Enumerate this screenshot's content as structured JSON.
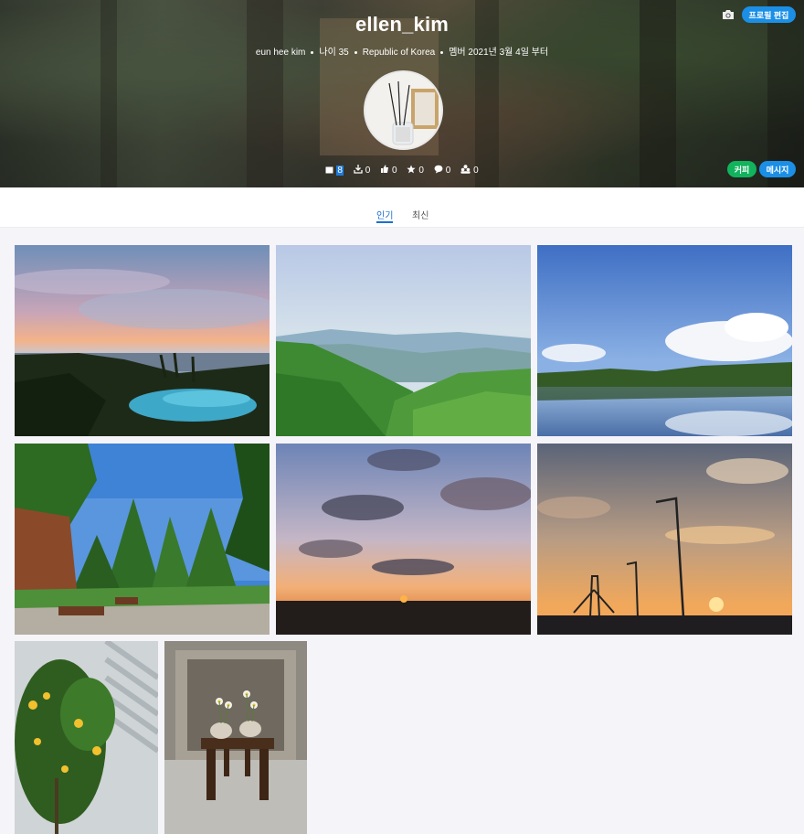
{
  "profile": {
    "username": "ellen_kim",
    "full_name": "eun hee kim",
    "age": "나이 35",
    "country": "Republic of Korea",
    "member_since": "멤버 2021년 3월 4일 부터"
  },
  "stats": {
    "photos": "8",
    "downloads": "0",
    "likes": "0",
    "favorites": "0",
    "comments": "0",
    "followers": "0"
  },
  "buttons": {
    "edit_profile": "프로필 편집",
    "coffee": "커피",
    "message": "메시지"
  },
  "tabs": [
    {
      "label": "인기",
      "active": true
    },
    {
      "label": "최신",
      "active": false
    }
  ],
  "colors": {
    "accent_blue": "#1b8fe6",
    "coffee_green": "#12b35d",
    "tab_active": "#1b6fd0",
    "page_bg": "#f5f4f9"
  },
  "photos": [
    {
      "name": "tropical-sunset-pool"
    },
    {
      "name": "green-mountain-valley"
    },
    {
      "name": "lake-reflection-clouds"
    },
    {
      "name": "park-trees-bench"
    },
    {
      "name": "sunset-sky-clouds"
    },
    {
      "name": "bridge-street-lamp-sunset"
    },
    {
      "name": "lemon-tree-wall"
    },
    {
      "name": "wooden-stool-flowers"
    }
  ]
}
